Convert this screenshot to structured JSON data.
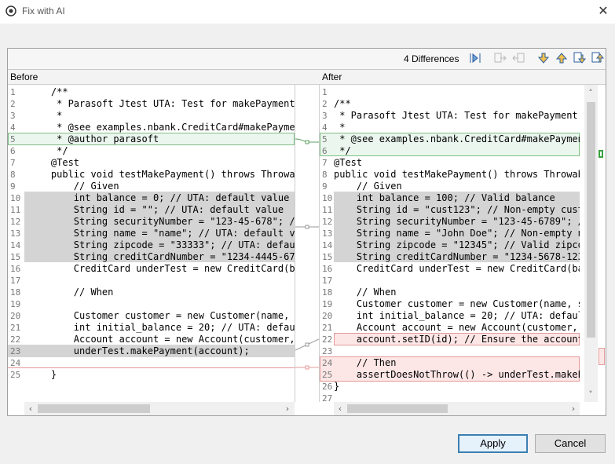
{
  "window": {
    "title": "Fix with AI",
    "close_glyph": "✕"
  },
  "toolbar": {
    "diff_count": "4 Differences"
  },
  "panes": {
    "before": {
      "header": "Before",
      "lines": [
        {
          "n": "1",
          "t": "    /**"
        },
        {
          "n": "2",
          "t": "     * Parasoft Jtest UTA: Test for makePayment(A"
        },
        {
          "n": "3",
          "t": "     *"
        },
        {
          "n": "4",
          "t": "     * @see examples.nbank.CreditCard#makePayment"
        },
        {
          "n": "5",
          "t": "     * @author parasoft"
        },
        {
          "n": "6",
          "t": "     */"
        },
        {
          "n": "7",
          "t": "    @Test"
        },
        {
          "n": "8",
          "t": "    public void testMakePayment() throws Throwabl"
        },
        {
          "n": "9",
          "t": "        // Given"
        },
        {
          "n": "10",
          "t": "        int balance = 0; // UTA: default value"
        },
        {
          "n": "11",
          "t": "        String id = \"\"; // UTA: default value"
        },
        {
          "n": "12",
          "t": "        String securityNumber = \"123-45-678\"; //"
        },
        {
          "n": "13",
          "t": "        String name = \"name\"; // UTA: default val"
        },
        {
          "n": "14",
          "t": "        String zipcode = \"33333\"; // UTA: default"
        },
        {
          "n": "15",
          "t": "        String creditCardNumber = \"1234-4445-6789"
        },
        {
          "n": "16",
          "t": "        CreditCard underTest = new CreditCard(bal"
        },
        {
          "n": "17",
          "t": ""
        },
        {
          "n": "18",
          "t": "        // When"
        },
        {
          "n": "19",
          "t": ""
        },
        {
          "n": "20",
          "t": "        Customer customer = new Customer(name, se"
        },
        {
          "n": "21",
          "t": "        int initial_balance = 20; // UTA: default"
        },
        {
          "n": "22",
          "t": "        Account account = new Account(customer, i"
        },
        {
          "n": "23",
          "t": "        underTest.makePayment(account);"
        },
        {
          "n": "24",
          "t": ""
        },
        {
          "n": "25",
          "t": "    }"
        }
      ]
    },
    "after": {
      "header": "After",
      "lines": [
        {
          "n": "1",
          "t": ""
        },
        {
          "n": "2",
          "t": "/**"
        },
        {
          "n": "3",
          "t": " * Parasoft Jtest UTA: Test for makePayment(A"
        },
        {
          "n": "4",
          "t": " *"
        },
        {
          "n": "5",
          "t": " * @see examples.nbank.CreditCard#makePayment"
        },
        {
          "n": "6",
          "t": " */"
        },
        {
          "n": "7",
          "t": "@Test"
        },
        {
          "n": "8",
          "t": "public void testMakePayment() throws Throwabl"
        },
        {
          "n": "9",
          "t": "    // Given"
        },
        {
          "n": "10",
          "t": "    int balance = 100; // Valid balance"
        },
        {
          "n": "11",
          "t": "    String id = \"cust123\"; // Non-empty cust"
        },
        {
          "n": "12",
          "t": "    String securityNumber = \"123-45-6789\"; //"
        },
        {
          "n": "13",
          "t": "    String name = \"John Doe\"; // Non-empty na"
        },
        {
          "n": "14",
          "t": "    String zipcode = \"12345\"; // Valid zipco"
        },
        {
          "n": "15",
          "t": "    String creditCardNumber = \"1234-5678-1234"
        },
        {
          "n": "16",
          "t": "    CreditCard underTest = new CreditCard(bal"
        },
        {
          "n": "17",
          "t": ""
        },
        {
          "n": "18",
          "t": "    // When"
        },
        {
          "n": "19",
          "t": "    Customer customer = new Customer(name, se"
        },
        {
          "n": "20",
          "t": "    int initial_balance = 20; // UTA: defaul"
        },
        {
          "n": "21",
          "t": "    Account account = new Account(customer, i"
        },
        {
          "n": "22",
          "t": "    account.setID(id); // Ensure the account"
        },
        {
          "n": "23",
          "t": ""
        },
        {
          "n": "24",
          "t": "    // Then"
        },
        {
          "n": "25",
          "t": "    assertDoesNotThrow(() -> underTest.makePa"
        },
        {
          "n": "26",
          "t": "}"
        },
        {
          "n": "27",
          "t": ""
        }
      ]
    }
  },
  "buttons": {
    "apply": "Apply",
    "cancel": "Cancel"
  },
  "colors": {
    "accent": "#3c7fb1",
    "change_gray": "#d4d4d4",
    "add_green": "#ebf7ee",
    "del_red": "#fde6e6"
  }
}
